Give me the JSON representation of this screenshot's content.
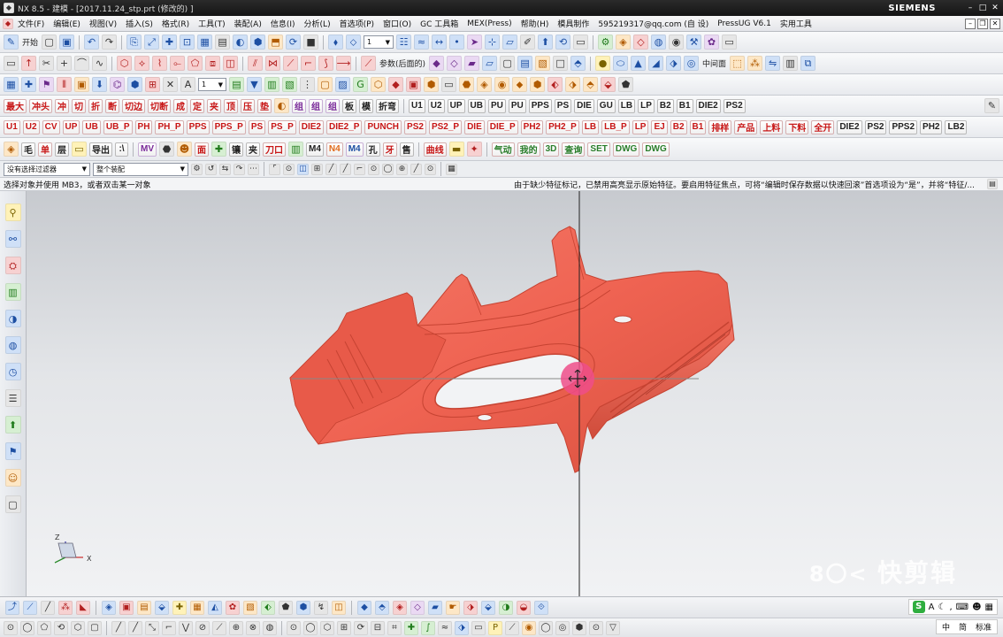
{
  "titlebar": {
    "title": "NX 8.5 - 建模 - [2017.11.24_stp.prt (修改的) ]",
    "brand": "SIEMENS"
  },
  "menubar": {
    "items": [
      "文件(F)",
      "编辑(E)",
      "视图(V)",
      "插入(S)",
      "格式(R)",
      "工具(T)",
      "装配(A)",
      "信息(I)",
      "分析(L)",
      "首选项(P)",
      "窗口(O)",
      "GC 工具箱",
      "MEX(Press)",
      "帮助(H)",
      "模具制作",
      "595219317@qq.com (自 设)",
      "PressUG V6.1",
      "实用工具"
    ]
  },
  "toolbar1": {
    "labels": [
      "开始"
    ]
  },
  "toolbar2": {
    "labels": [
      "参数(后面的)",
      "中间面"
    ]
  },
  "toolbar4": {
    "labels": [
      "最大",
      "冲头",
      "切边",
      "切断",
      "组",
      "组",
      "组",
      "折弯",
      "U1",
      "U2",
      "UP",
      "UB",
      "PU",
      "PU",
      "PPS",
      "PS",
      "DIE",
      "GU",
      "LB",
      "LP",
      "B2",
      "B1",
      "DIE2",
      "PS2"
    ]
  },
  "toolbar5": {
    "labels": [
      "U1",
      "U2",
      "CV",
      "UP",
      "UB",
      "UB_P",
      "PH",
      "PH_P",
      "PPS",
      "PPS_P",
      "PS",
      "PS_P",
      "DIE2",
      "DIE2_P",
      "PUNCH",
      "PS2",
      "PS2_P",
      "DIE",
      "DIE_P",
      "PH2",
      "PH2_P",
      "LB",
      "LB_P",
      "LP",
      "EJ",
      "B2",
      "B1",
      "排样",
      "产品",
      "上料",
      "下料",
      "全开",
      "DIE2",
      "PS2",
      "PPS2",
      "PH2",
      "LB2"
    ]
  },
  "toolbar6": {
    "labels": [
      "毛",
      "单",
      "层",
      "导出",
      ":\\",
      "MV",
      "M4",
      "N4",
      "M4",
      "孔",
      "牙",
      "锥",
      "夹",
      "刀口",
      "售",
      "曲线",
      "气动",
      "我的",
      "3D",
      "查询",
      "SET",
      "DWG",
      "DWG"
    ]
  },
  "filterbar": {
    "type_filter": "没有选择过滤器",
    "scope": "整个装配"
  },
  "cue": {
    "left": "选择对象并使用 MB3，或者双击某一对象",
    "right": "由于缺少特征标记，已禁用高亮显示原始特征。要启用特征焦点，可将“编辑时保存数据以快速回滚”首选项设为“是”，并将“特征/..."
  },
  "viewport": {
    "part_color": "#ef6352",
    "bg_top": "#c7cacf",
    "bg_bottom": "#f1f2f4",
    "triad": {
      "z": "Z",
      "x": "X",
      "y": "Y"
    },
    "watermark": "快剪辑"
  },
  "ime": {
    "label": "A"
  },
  "lang": {
    "items": [
      "中",
      "简",
      "标准"
    ]
  }
}
